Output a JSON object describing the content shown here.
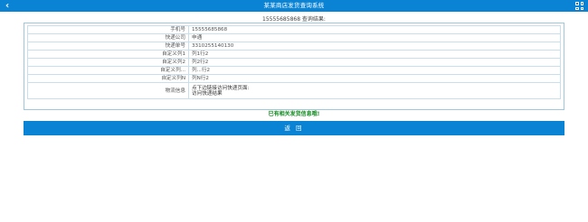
{
  "header": {
    "title": "某某商店发货查询系统",
    "back_icon": "back-arrow-icon",
    "menu_icon": "grid-menu-icon"
  },
  "result_heading": "15555685868 查询结果:",
  "rows": [
    {
      "label": "手机号",
      "value": "15555685868"
    },
    {
      "label": "快递公司",
      "value": "申通"
    },
    {
      "label": "快递单号",
      "value": "3310255140130"
    },
    {
      "label": "自定义列1",
      "value": "列1行2"
    },
    {
      "label": "自定义列2",
      "value": "列2行2"
    },
    {
      "label": "自定义列...",
      "value": "列...行2"
    },
    {
      "label": "自定义列N",
      "value": "列N行2"
    }
  ],
  "info_row": {
    "label": "物流信息",
    "line1": "点下边链接访问快递页面:",
    "line2": "访问快递结果"
  },
  "notice": "已有相关发货信息哦!",
  "return_button": "返 回",
  "colors": {
    "primary": "#0b83d4",
    "notice": "#0e8a1e"
  }
}
